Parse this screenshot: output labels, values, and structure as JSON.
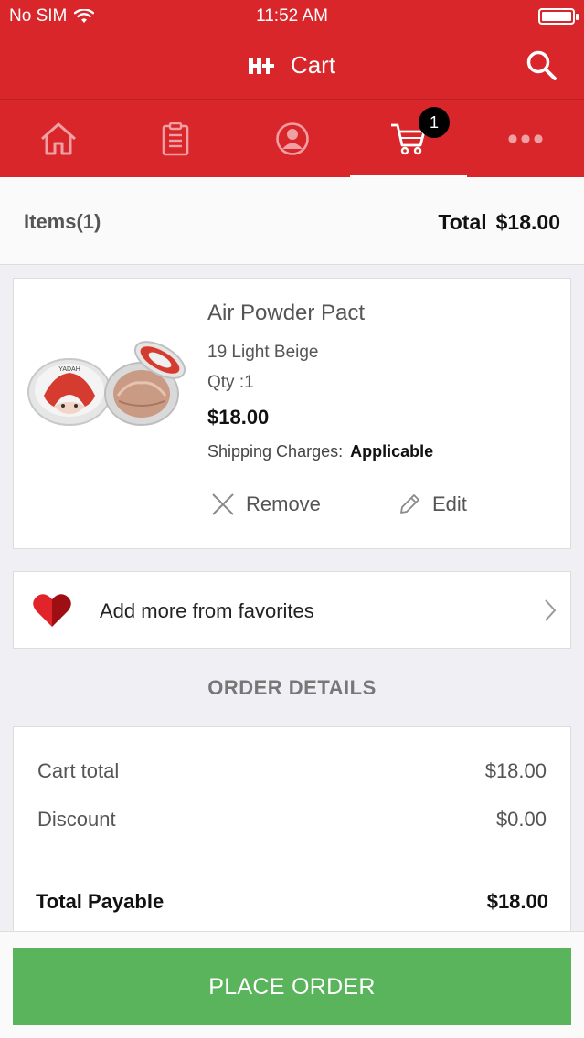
{
  "status_bar": {
    "carrier": "No SIM",
    "time": "11:52 AM",
    "battery_level": 1.0
  },
  "nav": {
    "title": "Cart",
    "logo_text": "H+",
    "search_icon": "search-icon"
  },
  "tabs": [
    {
      "name": "home",
      "icon": "home-icon",
      "active": false
    },
    {
      "name": "orders",
      "icon": "clipboard-icon",
      "active": false
    },
    {
      "name": "account",
      "icon": "user-icon",
      "active": false
    },
    {
      "name": "cart",
      "icon": "cart-icon",
      "active": true,
      "badge": "1"
    },
    {
      "name": "more",
      "icon": "more-icon",
      "active": false
    }
  ],
  "items_header": {
    "label": "Items",
    "count": "(1)",
    "total_label": "Total",
    "total_value": "$18.00"
  },
  "product": {
    "name": "Air Powder Pact",
    "variant": "19 Light Beige",
    "qty": "Qty :1",
    "price": "$18.00",
    "shipping_label": "Shipping Charges:",
    "shipping_value": "Applicable",
    "remove_label": "Remove",
    "edit_label": "Edit",
    "image_brand_text": "YADAH"
  },
  "favorites": {
    "label": "Add more from favorites"
  },
  "order_details": {
    "heading": "ORDER DETAILS",
    "rows": [
      {
        "label": "Cart total",
        "value": "$18.00"
      },
      {
        "label": "Discount",
        "value": "$0.00"
      }
    ],
    "total_label": "Total Payable",
    "total_value": "$18.00"
  },
  "footer": {
    "place_order_label": "PLACE ORDER"
  },
  "colors": {
    "brand_red": "#d8262b",
    "action_green": "#59b45b",
    "background": "#efeff4"
  }
}
